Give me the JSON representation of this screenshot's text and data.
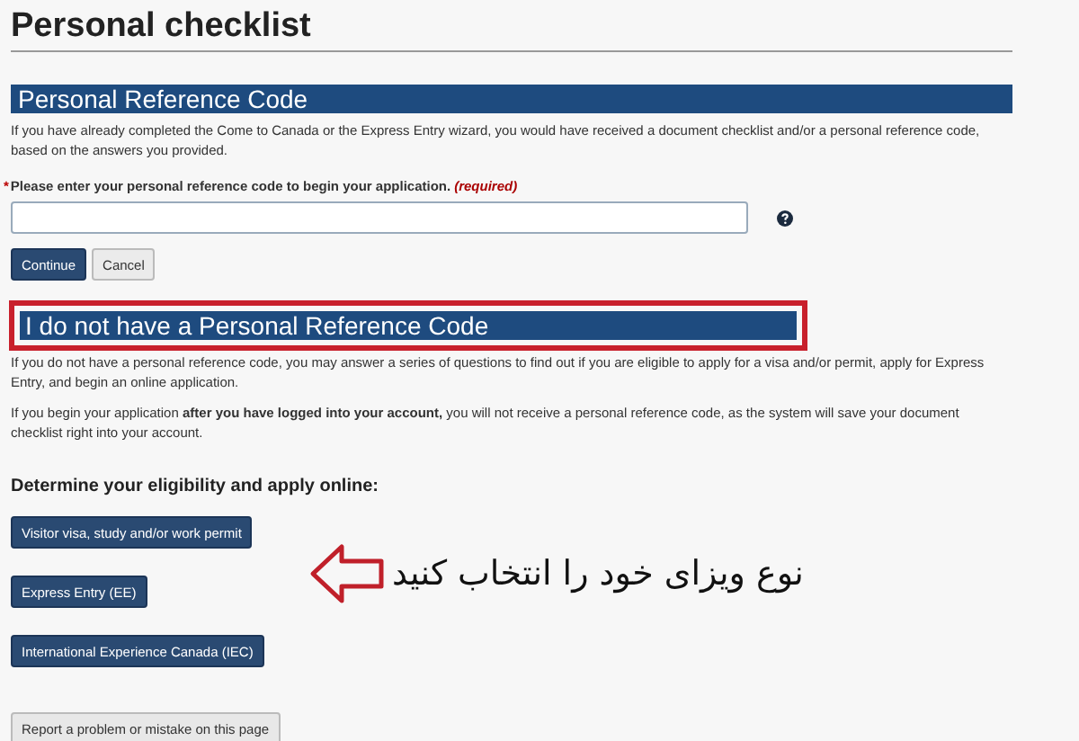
{
  "page_title": "Personal checklist",
  "reference_section": {
    "heading": "Personal Reference Code",
    "intro": "If you have already completed the Come to Canada or the Express Entry wizard, you would have received a document checklist and/or a personal reference code, based on the answers you provided.",
    "field_label": "Please enter your personal reference code to begin your application.",
    "required_mark": "*",
    "required_text": "(required)",
    "buttons": [
      {
        "label": "Continue",
        "kind": "primary"
      },
      {
        "label": "Cancel",
        "kind": "secondary"
      }
    ]
  },
  "no_code_section": {
    "heading": "I do not have a Personal Reference Code",
    "highlighted": true,
    "paragraphs": [
      "If you do not have a personal reference code, you may answer a series of questions to find out if you are eligible to apply for a visa and/or permit, apply for Express Entry, and begin an online application.",
      "If you begin your application **after you have logged into your account,** you will not receive a personal reference code, as the system will save your document checklist right into your account."
    ],
    "subheading": "Determine your eligibility and apply online:",
    "options": [
      {
        "label": "Visitor visa, study and/or work permit"
      },
      {
        "label": "Express Entry (EE)"
      },
      {
        "label": "International Experience Canada (IEC)"
      }
    ]
  },
  "annotation": {
    "text": "نوع ویزای خود را انتخاب کنید"
  },
  "report_button": "Report a problem or mistake on this page"
}
